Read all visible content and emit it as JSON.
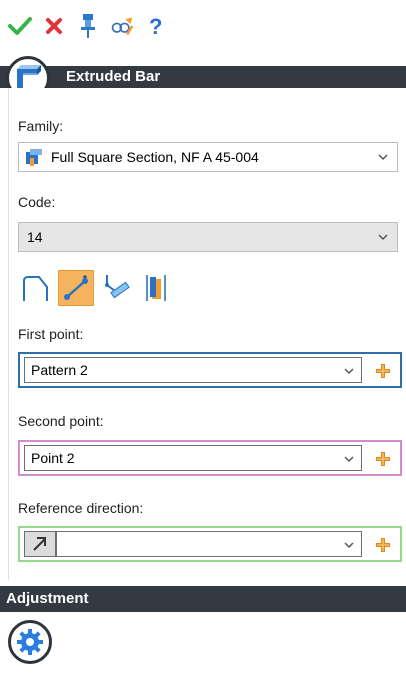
{
  "toolbar": {
    "icons": [
      "check-icon",
      "close-icon",
      "pin-icon",
      "preview-icon",
      "help-icon"
    ],
    "colors": {
      "check": "#36b54a",
      "close": "#e3333a",
      "pin": "#2a78c6",
      "help": "#2a6fd6"
    }
  },
  "panel": {
    "title": "Extruded Bar",
    "header_icon": "extruded-bar-icon"
  },
  "family": {
    "label": "Family:",
    "value": "Full Square Section, NF A 45-004",
    "icon": "profile-icon"
  },
  "code": {
    "label": "Code:",
    "value": "14"
  },
  "creation_modes": {
    "buttons": [
      "profile-path-mode",
      "two-points-mode",
      "point-direction-length-mode",
      "bounded-mode"
    ],
    "active_index": 1
  },
  "first_point": {
    "label": "First point:",
    "value": "Pattern 2",
    "frame_color": "#2e6fa7"
  },
  "second_point": {
    "label": "Second point:",
    "value": "Point 2",
    "frame_color": "#d58bd0"
  },
  "reference_direction": {
    "label": "Reference direction:",
    "value": "",
    "frame_color": "#93d98a"
  },
  "adjustment": {
    "title": "Adjustment"
  }
}
